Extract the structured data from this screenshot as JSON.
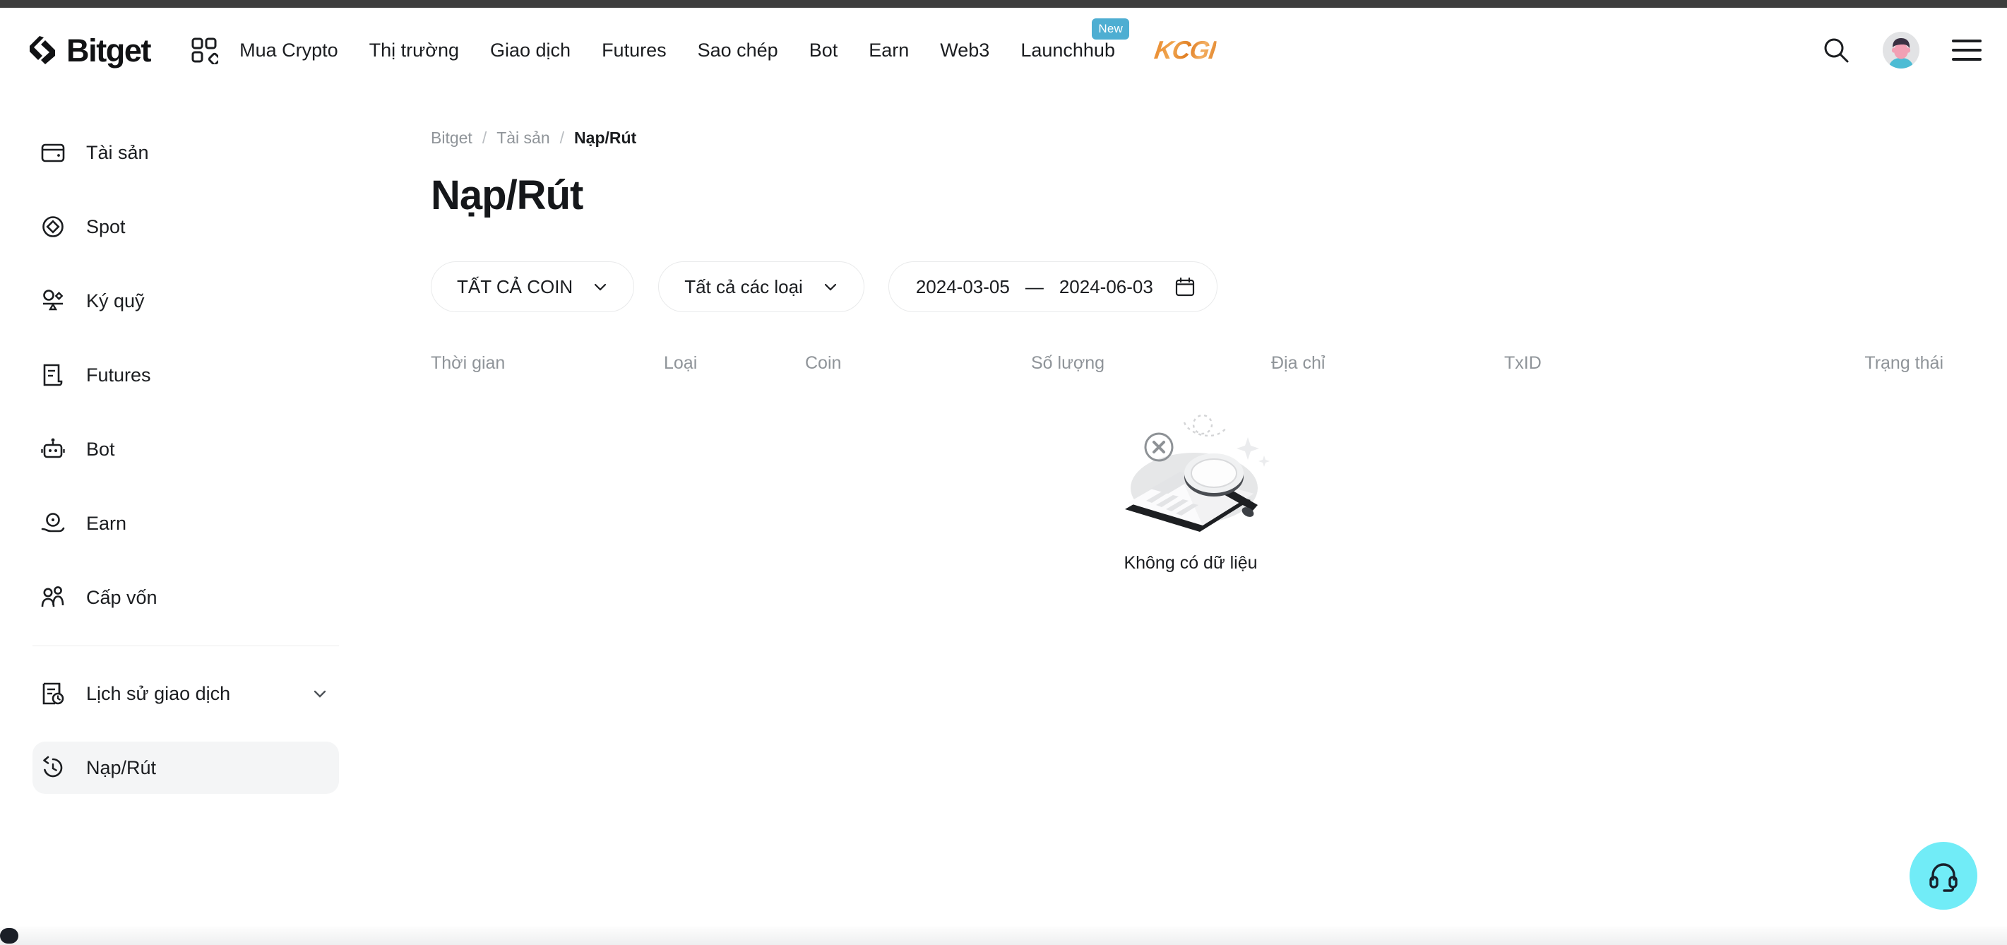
{
  "header": {
    "logo_text": "Bitget",
    "logo_mark_icon": "bitget-chevron-logo",
    "apps_grid_icon": "apps-grid-icon",
    "nav": [
      {
        "label": "Mua Crypto",
        "badge": ""
      },
      {
        "label": "Thị trường",
        "badge": ""
      },
      {
        "label": "Giao dịch",
        "badge": ""
      },
      {
        "label": "Futures",
        "badge": ""
      },
      {
        "label": "Sao chép",
        "badge": ""
      },
      {
        "label": "Bot",
        "badge": ""
      },
      {
        "label": "Earn",
        "badge": ""
      },
      {
        "label": "Web3",
        "badge": ""
      },
      {
        "label": "Launchhub",
        "badge": "New"
      }
    ],
    "promo_logo_text": "KCGI",
    "search_icon": "search-icon",
    "avatar_icon": "user-avatar",
    "menu_icon": "hamburger-menu-icon",
    "badge_color": "#4eaed2",
    "promo_color": "#e2852b"
  },
  "sidebar": {
    "items": [
      {
        "label": "Tài sản",
        "icon": "wallet-icon",
        "active": false,
        "chevron": false
      },
      {
        "label": "Spot",
        "icon": "spot-coin-icon",
        "active": false,
        "chevron": false
      },
      {
        "label": "Ký quỹ",
        "icon": "margin-scale-icon",
        "active": false,
        "chevron": false
      },
      {
        "label": "Futures",
        "icon": "futures-document-icon",
        "active": false,
        "chevron": false
      },
      {
        "label": "Bot",
        "icon": "robot-icon",
        "active": false,
        "chevron": false
      },
      {
        "label": "Earn",
        "icon": "earn-hand-coin-icon",
        "active": false,
        "chevron": false
      },
      {
        "label": "Cấp vốn",
        "icon": "users-funding-icon",
        "active": false,
        "chevron": false
      }
    ],
    "group_items": [
      {
        "label": "Lịch sử giao dịch",
        "icon": "history-document-icon",
        "active": false,
        "chevron": true
      },
      {
        "label": "Nạp/Rút",
        "icon": "deposit-withdraw-history-icon",
        "active": true,
        "chevron": false
      }
    ]
  },
  "main": {
    "breadcrumb": [
      {
        "label": "Bitget",
        "current": false
      },
      {
        "label": "Tài sản",
        "current": false
      },
      {
        "label": "Nạp/Rút",
        "current": true
      }
    ],
    "breadcrumb_separator": "/",
    "page_title": "Nạp/Rút",
    "filters": {
      "coin_select": {
        "value": "TẤT CẢ COIN",
        "icon": "chevron-down-icon"
      },
      "type_select": {
        "value": "Tất cả các loại",
        "icon": "chevron-down-icon"
      },
      "date_range": {
        "start": "2024-03-05",
        "separator": "—",
        "end": "2024-06-03",
        "icon": "calendar-icon"
      }
    },
    "table": {
      "columns": [
        "Thời gian",
        "Loại",
        "Coin",
        "Số lượng",
        "Địa chỉ",
        "TxID",
        "Trạng thái"
      ],
      "rows": []
    },
    "empty_state": {
      "text": "Không có dữ liệu",
      "illustration": "no-data-document-magnifier-illustration"
    }
  },
  "support": {
    "icon": "headset-support-icon",
    "color": "#71ecf7"
  },
  "scrollbar": {
    "horizontal_thumb_position": "left"
  }
}
